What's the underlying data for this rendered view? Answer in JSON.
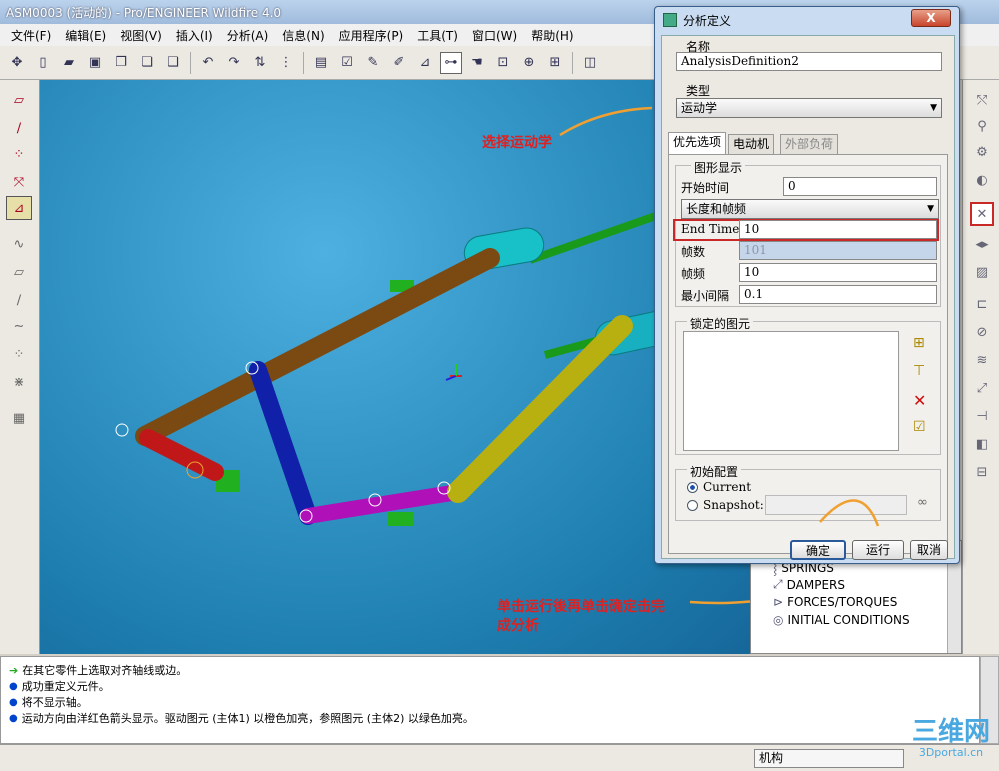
{
  "window": {
    "title": "ASM0003 (活动的) - Pro/ENGINEER Wildfire 4.0"
  },
  "menu": [
    "文件(F)",
    "编辑(E)",
    "视图(V)",
    "插入(I)",
    "分析(A)",
    "信息(N)",
    "应用程序(P)",
    "工具(T)",
    "窗口(W)",
    "帮助(H)"
  ],
  "dialog": {
    "title": "分析定义",
    "close": "X",
    "name_label": "名称",
    "name_value": "AnalysisDefinition2",
    "type_label": "类型",
    "type_value": "运动学",
    "tabs": [
      "优先选项",
      "电动机",
      "外部负荷"
    ],
    "graphic_display_label": "图形显示",
    "start_time_label": "开始时间",
    "start_time_value": "0",
    "mode_value": "长度和帧频",
    "end_time_label": "End Time",
    "end_time_value": "10",
    "frames_label": "帧数",
    "frames_value": "101",
    "frame_rate_label": "帧频",
    "frame_rate_value": "10",
    "min_interval_label": "最小间隔",
    "min_interval_value": "0.1",
    "locked_label": "锁定的图元",
    "init_label": "初始配置",
    "radio_current": "Current",
    "radio_snapshot": "Snapshot:",
    "ok": "确定",
    "run": "运行",
    "cancel": "取消"
  },
  "annotations": {
    "select_kinematics": "选择运动学",
    "run_then_ok_line1": "单击运行後再单击确定击完",
    "run_then_ok_line2": "成分析"
  },
  "tree": [
    "SPRINGS",
    "DAMPERS",
    "FORCES/TORQUES",
    "INITIAL CONDITIONS"
  ],
  "messages": [
    "在其它零件上选取对齐轴线或边。",
    "成功重定义元件。",
    "将不显示轴。",
    "运动方向由洋红色箭头显示。驱动图元 (主体1) 以橙色加亮，参照图元 (主体2) 以绿色加亮。"
  ],
  "status": {
    "mode": "机构"
  },
  "logo": {
    "main": "三维网",
    "sub": "3Dportal.cn"
  },
  "colors": {
    "annotation": "#e02020",
    "arrow": "#f0a030"
  }
}
